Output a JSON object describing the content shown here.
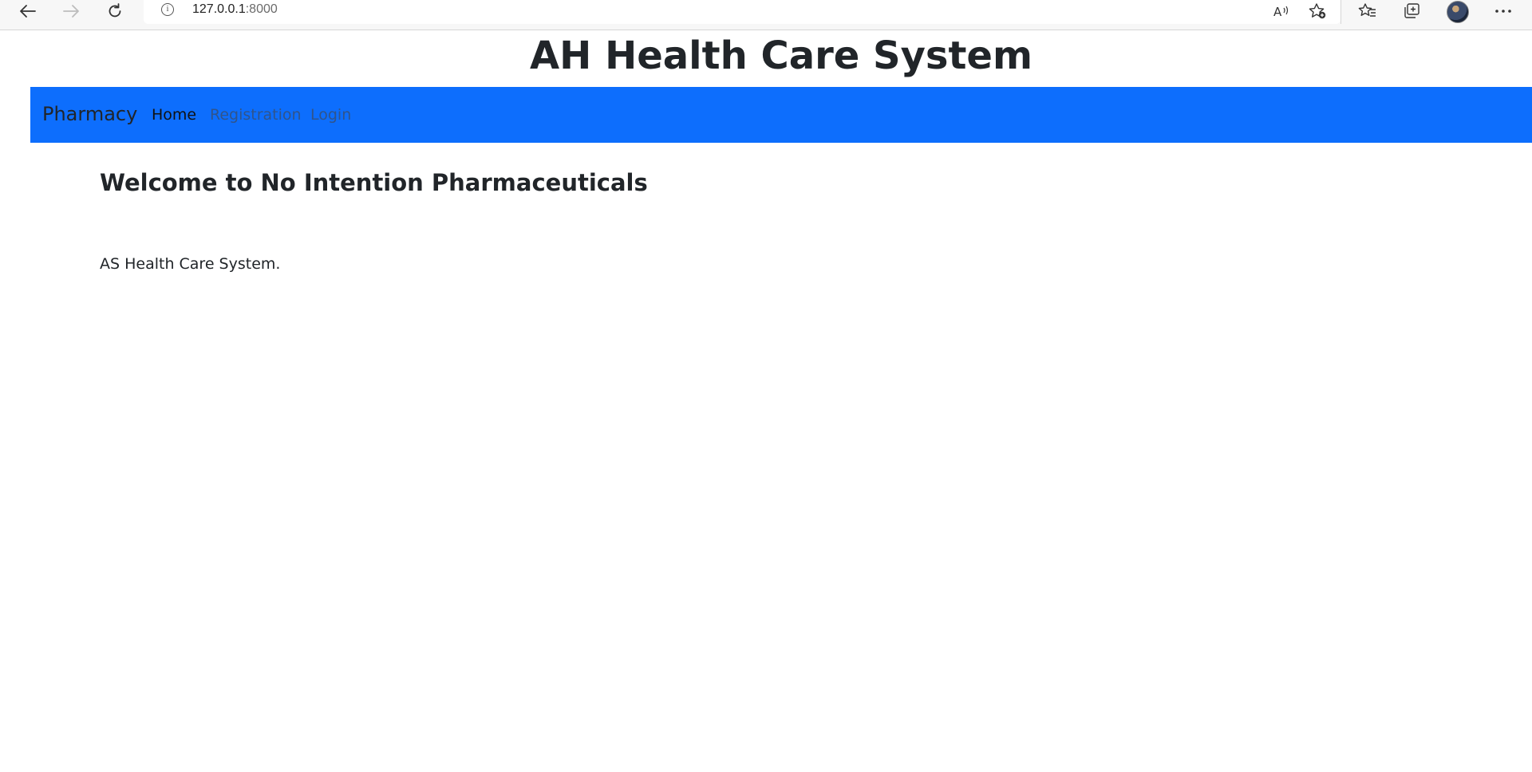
{
  "browser": {
    "url_host": "127.0.0.1",
    "url_port": ":8000",
    "icons": {
      "back": "back-arrow-icon",
      "forward": "forward-arrow-icon",
      "reload": "reload-icon",
      "info": "info-icon",
      "read_aloud": "read-aloud-icon",
      "add_favorite": "add-favorite-icon",
      "favorites": "favorites-icon",
      "collections": "collections-icon",
      "profile": "profile-avatar",
      "more": "more-icon"
    }
  },
  "page": {
    "site_title": "AH Health Care System",
    "navbar": {
      "brand": "Pharmacy",
      "background": "#0d6efd",
      "links": [
        {
          "label": "Home",
          "active": true
        },
        {
          "label": "Registration",
          "active": false
        },
        {
          "label": "Login",
          "active": false
        }
      ]
    },
    "welcome_heading": "Welcome to No Intention Pharmaceuticals",
    "tagline": "AS Health Care System."
  }
}
